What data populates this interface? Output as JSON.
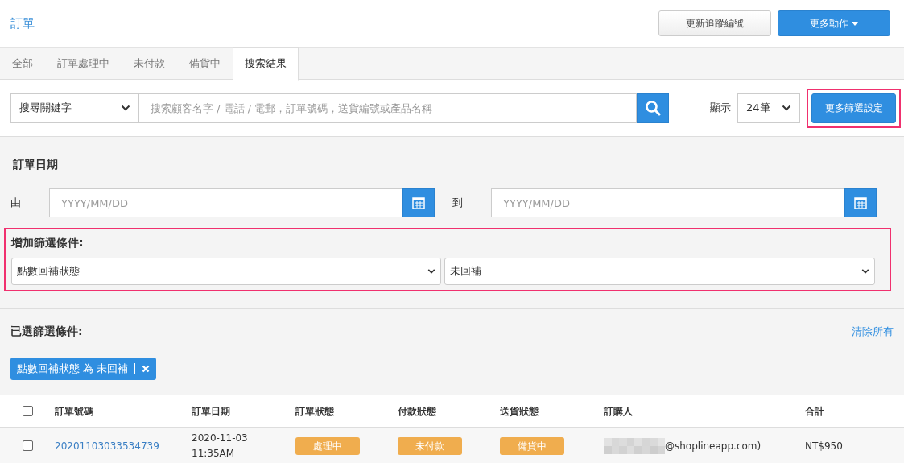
{
  "header": {
    "title": "訂單",
    "buttons": [
      {
        "label": "更新追蹤編號",
        "kind": "default"
      },
      {
        "label": "更多動作",
        "kind": "dropdown"
      }
    ]
  },
  "tabs": [
    {
      "label": "全部",
      "selected": false
    },
    {
      "label": "訂單處理中",
      "selected": false
    },
    {
      "label": "未付款",
      "selected": false
    },
    {
      "label": "備貨中",
      "selected": false
    },
    {
      "label": "搜索結果",
      "selected": true
    }
  ],
  "search": {
    "field_select": "搜尋關鍵字",
    "placeholder": "搜索顧客名字 / 電話 / 電郵，訂單號碼，送貨編號或產品名稱",
    "show_label": "顯示",
    "per_page": "24筆",
    "more_filters": {
      "label": "更多篩選設定",
      "highlighted": true
    }
  },
  "date_filter": {
    "title": "訂單日期",
    "from_label": "由",
    "from": {
      "placeholder": "YYYY/MM/DD"
    },
    "to_label": "到",
    "to": {
      "placeholder": "YYYY/MM/DD"
    }
  },
  "add_filter": {
    "title": "增加篩選條件:",
    "highlighted": true,
    "field": "點數回補狀態",
    "value": "未回補"
  },
  "selected_filters": {
    "title": "已選篩選條件:",
    "clear_all": "清除所有",
    "tags": [
      {
        "label": "點數回補狀態 為 未回補"
      }
    ]
  },
  "table": {
    "select_all": {
      "checked": false
    },
    "columns": [
      "訂單號碼",
      "訂單日期",
      "訂單狀態",
      "付款狀態",
      "送貨狀態",
      "訂購人",
      "合計"
    ],
    "rows": [
      {
        "checked": false,
        "order_no": "20201103033534739",
        "date": "2020-11-03",
        "time": "11:35AM",
        "order_status": {
          "label": "處理中",
          "color": "#f0ad4e"
        },
        "payment_status": {
          "label": "未付款",
          "color": "#f0ad4e"
        },
        "delivery_status": {
          "label": "備貨中",
          "color": "#f0ad4e"
        },
        "buyer": "@shoplineapp.com)",
        "total": "NT$950"
      }
    ]
  }
}
